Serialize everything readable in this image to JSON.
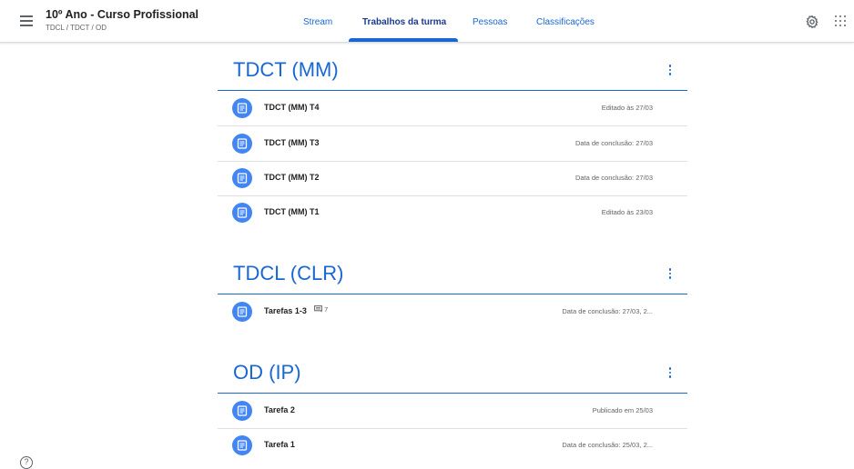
{
  "header": {
    "class_title": "10º Ano - Curso Profissional",
    "class_subtitle": "TDCL / TDCT / OD",
    "tabs": [
      {
        "label": "Stream"
      },
      {
        "label": "Trabalhos da turma"
      },
      {
        "label": "Pessoas"
      },
      {
        "label": "Classificações"
      }
    ],
    "active_tab": "Trabalhos da turma"
  },
  "sections": [
    {
      "title": "TDCT (MM)",
      "items": [
        {
          "name": "TDCT (MM) T4",
          "meta": "Editado às 27/03"
        },
        {
          "name": "TDCT (MM) T3",
          "meta": "Data de conclusão: 27/03"
        },
        {
          "name": "TDCT (MM) T2",
          "meta": "Data de conclusão: 27/03"
        },
        {
          "name": "TDCT (MM) T1",
          "meta": "Editado às 23/03"
        }
      ]
    },
    {
      "title": "TDCL (CLR)",
      "items": [
        {
          "name": "Tarefas 1-3",
          "comments": "7",
          "meta": "Data de conclusão: 27/03, 2..."
        }
      ]
    },
    {
      "title": "OD (IP)",
      "items": [
        {
          "name": "Tarefa 2",
          "meta": "Publicado em 25/03"
        },
        {
          "name": "Tarefa 1",
          "meta": "Data de conclusão: 25/03, 2..."
        }
      ]
    }
  ],
  "colors": {
    "accent": "#1967d2",
    "icon_bg": "#4285f4"
  },
  "icons": [
    "menu-icon",
    "gear-icon",
    "apps-icon",
    "assignment-icon",
    "comment-icon",
    "kebab-icon",
    "help-icon"
  ]
}
